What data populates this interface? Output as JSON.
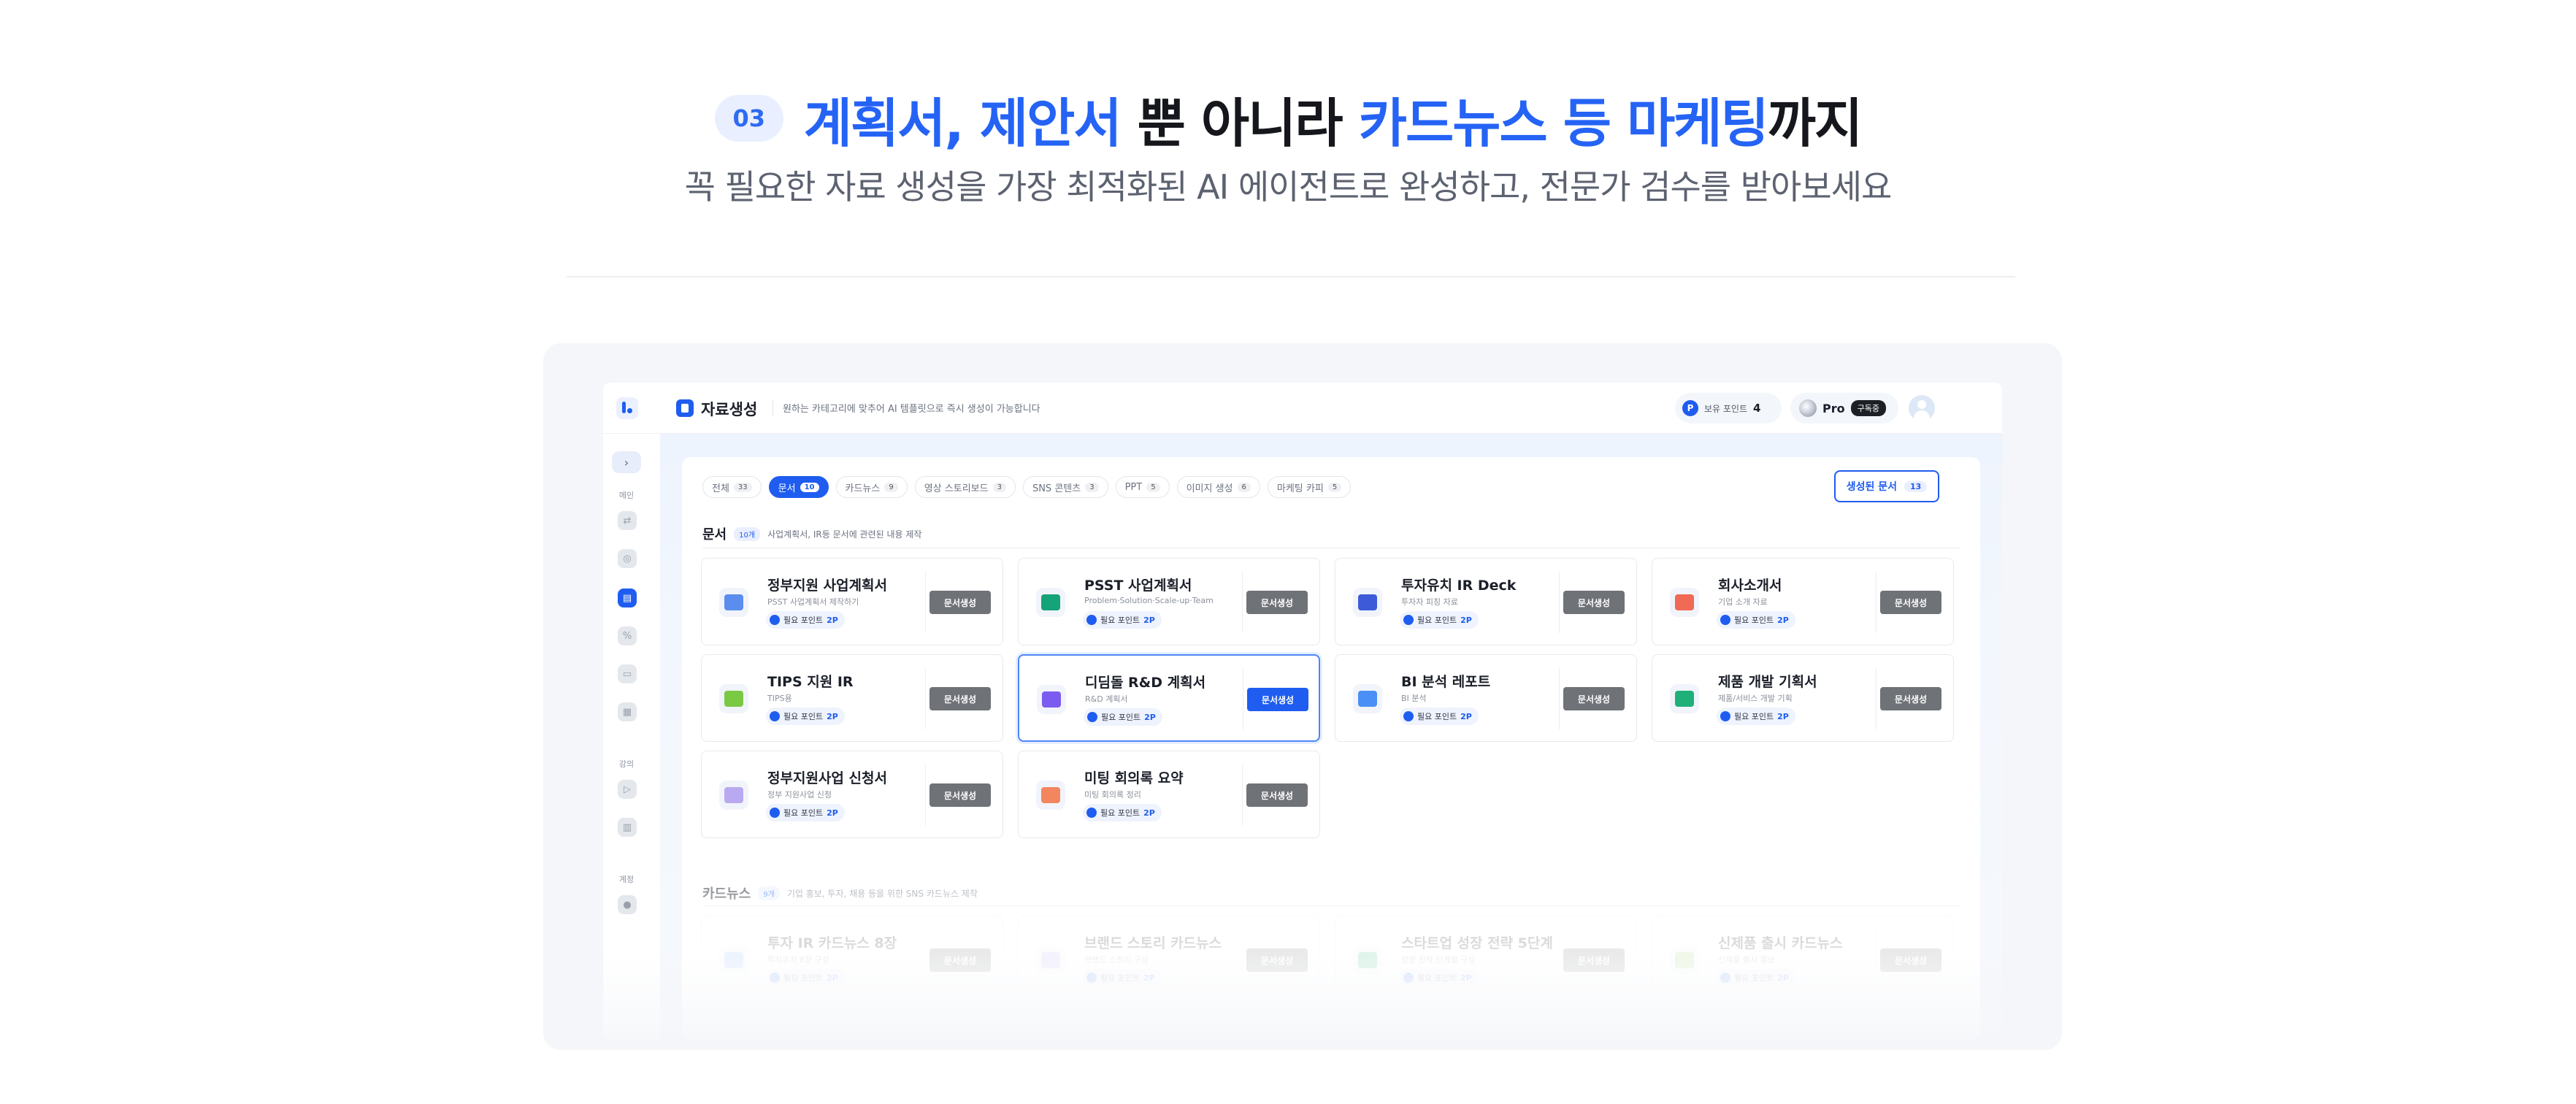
{
  "hero": {
    "step": "03",
    "headline": {
      "blue1": "계획서, 제안서",
      "dark1": " 뿐 아니라 ",
      "blue2": "카드뉴스 등 마케팅",
      "dark2": "까지"
    },
    "subhead": "꼭 필요한 자료 생성을 가장 최적화된 AI 에이전트로 완성하고, 전문가 검수를 받아보세요"
  },
  "topbar": {
    "title": "자료생성",
    "description": "원하는 카테고리에 맞추어 AI 템플릿으로 즉시 생성이 가능합니다",
    "points_label": "보유 포인트",
    "points_value": "4",
    "plan": "Pro",
    "plan_status": "구독중"
  },
  "sidebar": {
    "groups": [
      "메인",
      "강의",
      "계정"
    ]
  },
  "tabs": [
    {
      "label": "전체",
      "count": "33"
    },
    {
      "label": "문서",
      "count": "10"
    },
    {
      "label": "카드뉴스",
      "count": "9"
    },
    {
      "label": "영상 스토리보드",
      "count": "3"
    },
    {
      "label": "SNS 콘텐츠",
      "count": "3"
    },
    {
      "label": "PPT",
      "count": "5"
    },
    {
      "label": "이미지 생성",
      "count": "6"
    },
    {
      "label": "마케팅 카피",
      "count": "5"
    }
  ],
  "created": {
    "label": "생성된 문서",
    "count": "13"
  },
  "docs_section": {
    "title": "문서",
    "count": "10개",
    "description": "사업계획서, IR등 문서에 관련된 내용 제작",
    "cards": [
      {
        "title": "정부지원 사업계획서",
        "subtitle": "PSST 사업계획서 제작하기",
        "points": "필요 포인트",
        "cost": "2P",
        "button": "문서생성"
      },
      {
        "title": "PSST 사업계획서",
        "subtitle": "Problem·Solution·Scale-up·Team",
        "points": "필요 포인트",
        "cost": "2P",
        "button": "문서생성"
      },
      {
        "title": "투자유치 IR Deck",
        "subtitle": "투자자 피칭 자료",
        "points": "필요 포인트",
        "cost": "2P",
        "button": "문서생성"
      },
      {
        "title": "회사소개서",
        "subtitle": "기업 소개 자료",
        "points": "필요 포인트",
        "cost": "2P",
        "button": "문서생성"
      },
      {
        "title": "TIPS 지원 IR",
        "subtitle": "TIPS용",
        "points": "필요 포인트",
        "cost": "2P",
        "button": "문서생성"
      },
      {
        "title": "디딤돌 R&D 계획서",
        "subtitle": "R&D 계획서",
        "points": "필요 포인트",
        "cost": "2P",
        "button": "문서생성"
      },
      {
        "title": "BI 분석 레포트",
        "subtitle": "BI 분석",
        "points": "필요 포인트",
        "cost": "2P",
        "button": "문서생성"
      },
      {
        "title": "제품 개발 기획서",
        "subtitle": "제품/서비스 개발 기획",
        "points": "필요 포인트",
        "cost": "2P",
        "button": "문서생성"
      },
      {
        "title": "정부지원사업 신청서",
        "subtitle": "정부 지원사업 신청",
        "points": "필요 포인트",
        "cost": "2P",
        "button": "문서생성"
      },
      {
        "title": "미팅 회의록 요약",
        "subtitle": "미팅 회의록 정리",
        "points": "필요 포인트",
        "cost": "2P",
        "button": "문서생성"
      }
    ]
  },
  "cardnews_section": {
    "title": "카드뉴스",
    "count": "9개",
    "description": "기업 홍보, 투자, 채용 등을 위한 SNS 카드뉴스 제작",
    "cards": [
      {
        "title": "투자 IR 카드뉴스 8장",
        "subtitle": "투자유치 8장 구성",
        "points": "필요 포인트",
        "cost": "2P",
        "button": "문서생성"
      },
      {
        "title": "브랜드 스토리 카드뉴스",
        "subtitle": "브랜드 스토리 구성",
        "points": "필요 포인트",
        "cost": "2P",
        "button": "문서생성"
      },
      {
        "title": "스타트업 성장 전략 5단계",
        "subtitle": "성장 전략 단계별 구성",
        "points": "필요 포인트",
        "cost": "2P",
        "button": "문서생성"
      },
      {
        "title": "신제품 출시 카드뉴스",
        "subtitle": "신제품 출시 홍보",
        "points": "필요 포인트",
        "cost": "2P",
        "button": "문서생성"
      }
    ]
  },
  "colors": {
    "accent": "#1f5df0",
    "headline_blue": "#2563f5",
    "button_gray": "#6f7277"
  }
}
